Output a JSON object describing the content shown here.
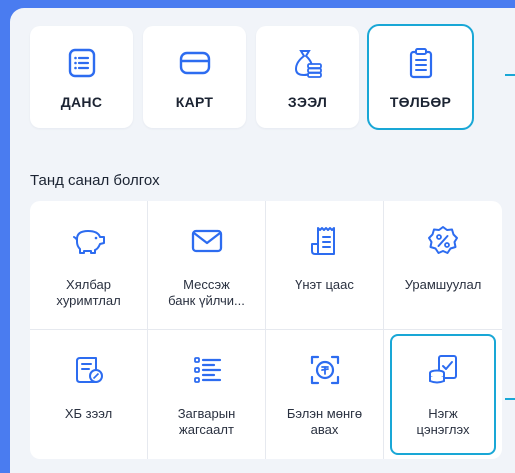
{
  "colors": {
    "accent": "#2d6cf0",
    "highlight": "#19a7d6"
  },
  "top_cards": [
    {
      "label": "ДАНС",
      "icon": "account-list-icon"
    },
    {
      "label": "КАРТ",
      "icon": "card-icon"
    },
    {
      "label": "ЗЭЭЛ",
      "icon": "loan-bag-icon"
    },
    {
      "label": "ТӨЛБӨР",
      "icon": "payment-clipboard-icon",
      "highlighted": true
    }
  ],
  "section": {
    "title": "Танд санал болгох"
  },
  "offers": [
    {
      "label": "Хялбар\nхуримтлал",
      "icon": "piggy-bank-icon"
    },
    {
      "label": "Мессэж\nбанк үйлчи...",
      "icon": "envelope-icon"
    },
    {
      "label": "Үнэт цаас",
      "icon": "securities-icon"
    },
    {
      "label": "Урамшуулал",
      "icon": "discount-badge-icon"
    },
    {
      "label": "ХБ зээл",
      "icon": "document-loan-icon"
    },
    {
      "label": "Загварын\nжагсаалт",
      "icon": "checklist-icon"
    },
    {
      "label": "Бэлэн мөнгө\nавах",
      "icon": "cash-withdraw-icon"
    },
    {
      "label": "Нэгж\nцэнэглэх",
      "icon": "topup-coins-icon",
      "highlighted": true
    }
  ]
}
